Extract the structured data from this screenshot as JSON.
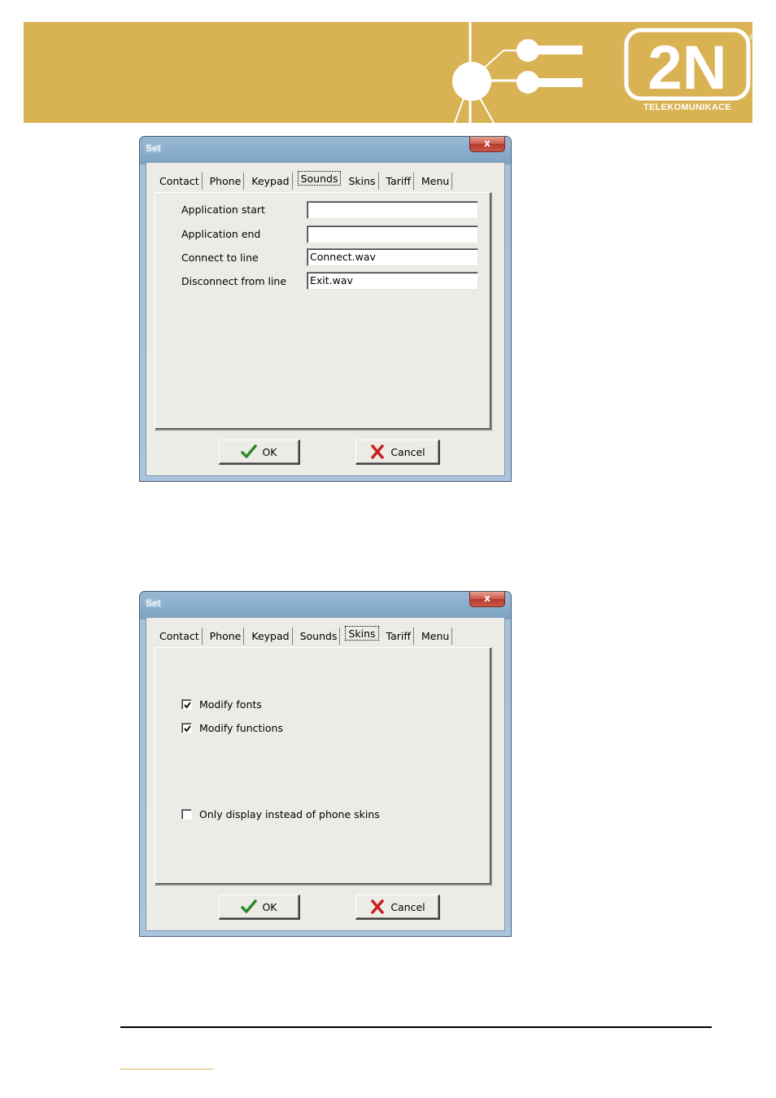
{
  "colors": {
    "banner_gold": "#d9b254",
    "accent_white": "#ffffff",
    "ok_check_green": "#2a8a2a",
    "cancel_x_red": "#c8201c"
  },
  "header": {
    "logo_text": "2N",
    "logo_subtitle": "TELEKOMUNIKACE",
    "registered_mark": "®"
  },
  "dialogs": [
    {
      "title": "Set",
      "close_label": "x",
      "tabs": [
        "Contact",
        "Phone",
        "Keypad",
        "Sounds",
        "Skins",
        "Tariff",
        "Menu"
      ],
      "selected_tab": "Sounds",
      "fields": [
        {
          "label": "Application start",
          "value": ""
        },
        {
          "label": "Application end",
          "value": ""
        },
        {
          "label": "Connect to line",
          "value": "Connect.wav"
        },
        {
          "label": "Disconnect from line",
          "value": "Exit.wav"
        }
      ],
      "ok_label": "OK",
      "cancel_label": "Cancel"
    },
    {
      "title": "Set",
      "close_label": "x",
      "tabs": [
        "Contact",
        "Phone",
        "Keypad",
        "Sounds",
        "Skins",
        "Tariff",
        "Menu"
      ],
      "selected_tab": "Skins",
      "checkboxes": [
        {
          "label": "Modify fonts",
          "checked": true
        },
        {
          "label": "Modify functions",
          "checked": true
        },
        {
          "label": "Only display instead of phone skins",
          "checked": false
        }
      ],
      "ok_label": "OK",
      "cancel_label": "Cancel"
    }
  ]
}
